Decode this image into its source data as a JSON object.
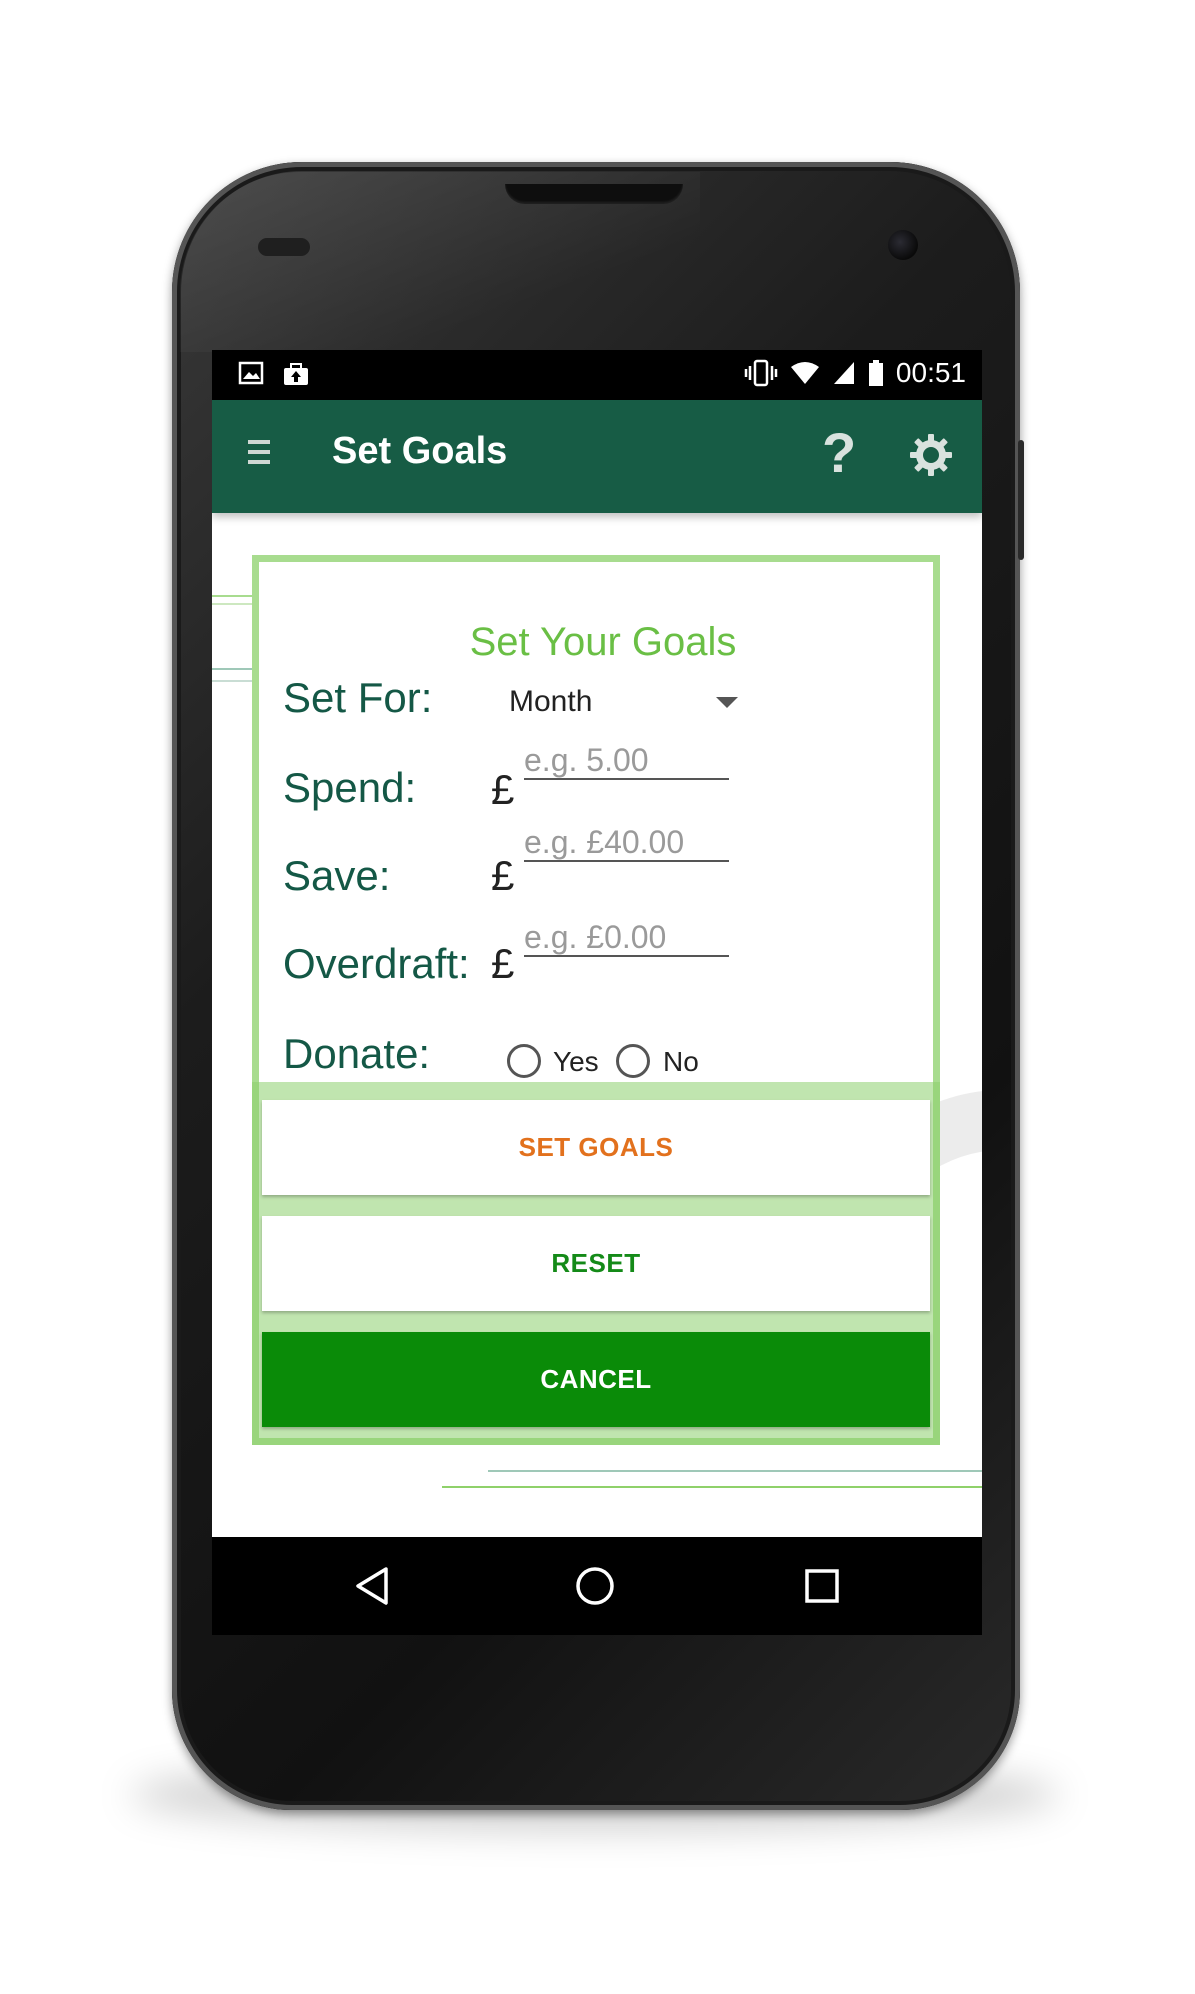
{
  "status_bar": {
    "left_icons": [
      "image-icon",
      "briefcase-upload-icon"
    ],
    "right_icons": [
      "vibrate-icon",
      "wifi-icon",
      "signal-icon",
      "battery-icon"
    ],
    "time": "00:51"
  },
  "app_bar": {
    "title": "Set Goals",
    "menu_icon": "hamburger-menu-icon",
    "help_label": "?",
    "settings_icon": "gear-icon"
  },
  "dialog": {
    "title": "Set Your Goals",
    "set_for": {
      "label": "Set For:",
      "selected": "Month"
    },
    "spend": {
      "label": "Spend:",
      "currency": "£",
      "placeholder": "e.g. 5.00"
    },
    "save": {
      "label": "Save:",
      "currency": "£",
      "placeholder": "e.g. £40.00"
    },
    "overdraft": {
      "label": "Overdraft:",
      "currency": "£",
      "placeholder": "e.g. £0.00"
    },
    "donate": {
      "label": "Donate:",
      "options": [
        "Yes",
        "No"
      ],
      "selected": null
    },
    "buttons": {
      "set_goals": "SET GOALS",
      "reset": "RESET",
      "cancel": "CANCEL"
    }
  },
  "colors": {
    "app_bar": "#175c45",
    "dialog_border": "#a8dc8f",
    "title_green": "#6abf45",
    "label_green": "#145846",
    "set_goals_text": "#e2711d",
    "reset_text": "#148a18",
    "cancel_bg": "#0a8b08"
  },
  "nav_bar": {
    "icons": [
      "back-icon",
      "home-icon",
      "recents-icon"
    ]
  }
}
